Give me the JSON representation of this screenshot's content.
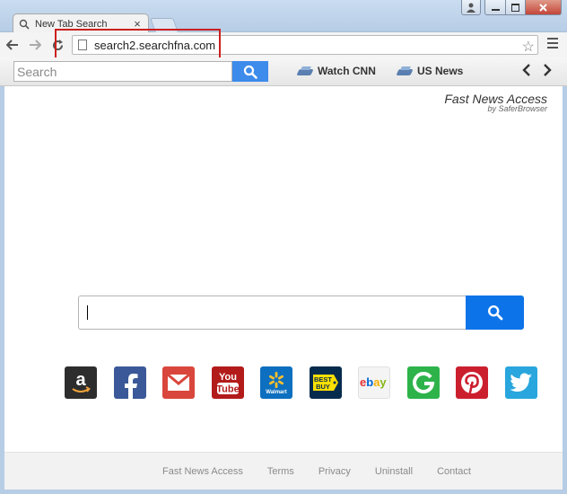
{
  "tab": {
    "title": "New Tab Search"
  },
  "address_bar": {
    "url": "search2.searchfna.com"
  },
  "extension_bar": {
    "search_placeholder": "Search",
    "links": [
      "Watch CNN",
      "US News"
    ]
  },
  "brand": {
    "title": "Fast News Access",
    "subtitle": "by SaferBrowser"
  },
  "shortcuts": {
    "youtube_text": "You Tube",
    "walmart_text": "Walmart",
    "bestbuy_text": "BEST BUY",
    "ebay_text": "ebay"
  },
  "footer": {
    "links": [
      "Fast News Access",
      "Terms",
      "Privacy",
      "Uninstall",
      "Contact"
    ]
  },
  "colors": {
    "search_button": "#0d73e8",
    "ext_search_button": "#3d8bea",
    "highlight_box": "#cc1f1f"
  }
}
